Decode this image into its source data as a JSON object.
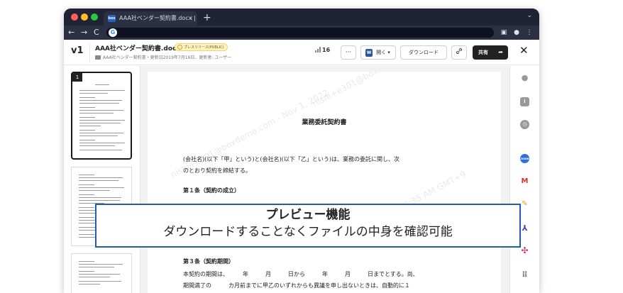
{
  "browser": {
    "tab_title": "AAA社ベンダー契約書.docx | Pow",
    "tab_favicon": "box",
    "tab_close": "×",
    "new_tab": "+",
    "tab_menu": "⌄",
    "back": "←",
    "forward": "→",
    "reload": "C",
    "omnibox_icon": "G",
    "omnibox_value": ""
  },
  "header": {
    "version": "v1",
    "file_name": "AAA社ベンダー契約書.docx",
    "badge": "プレスリリース(PUBLIC)",
    "meta": "AAA社ベンダー契約書・更新日2019年7月16日、更新者: ユーザー",
    "views": "16",
    "more": "···",
    "open_label": "開く",
    "open_icon": "W",
    "download_label": "ダウンロード",
    "share_label": "共有",
    "share_arrow": "➦",
    "close": "✕"
  },
  "thumbnails": [
    {
      "number": "1",
      "active": true
    },
    {
      "number": "",
      "active": false
    },
    {
      "number": "",
      "active": false
    }
  ],
  "document": {
    "title": "業務委託契約書",
    "para1": "(会社名)(以下「甲」という)と(会社名)(以下「乙」という)は、業務の委託に関し、次",
    "para2": "のとおり契約を締結する。",
    "article1": "第１条（契約の成立）",
    "article3": "第３条（契約期間）",
    "para3": "本契約の期間は、　　　年　　　月　　　日から　　　年　　　月　　　日までとする。尚、",
    "para4": "期間満了の　　　カ月前までに甲乙のいずれからも異議を申し出ないときは、自動的に１",
    "watermark1": "nishi+e301@boxdemo.com - Nov 1, 2022",
    "watermark2": "Nov 1, 2022, 6:08:35 AM GMT+9",
    "watermark3": "nishi+e301@boxdemo.com - Nov 1, 2022"
  },
  "banner": {
    "title": "プレビュー機能",
    "subtitle": "ダウンロードすることなくファイルの中身を確認可能"
  },
  "colors": {
    "accent": "#1e5fa8",
    "badge_bg": "#fff3c4",
    "share_bg": "#222222"
  }
}
